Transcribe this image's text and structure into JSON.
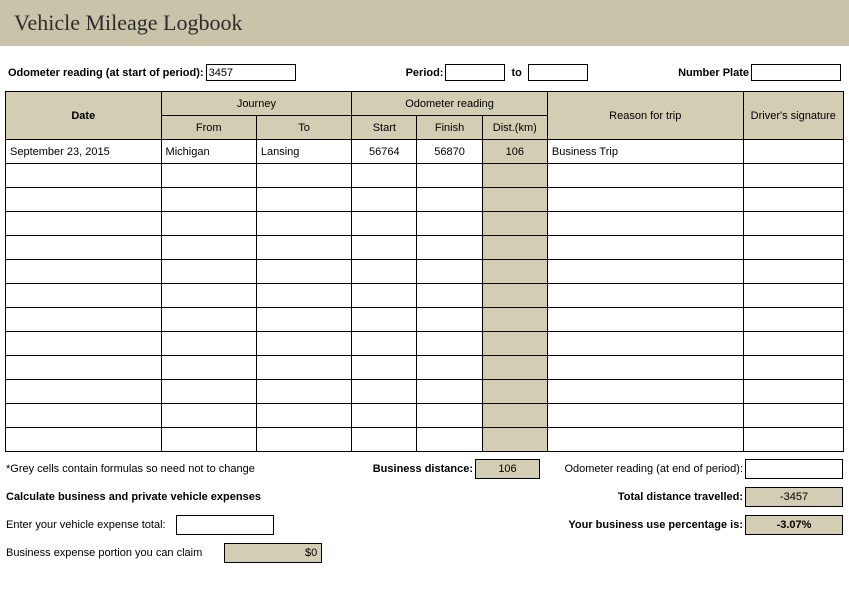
{
  "title": "Vehicle Mileage Logbook",
  "meta": {
    "odom_start_label": "Odometer reading (at start of period):",
    "odom_start_value": "3457",
    "period_label": "Period:",
    "period_from": "",
    "period_to_label": "to",
    "period_to": "",
    "plate_label": "Number Plate",
    "plate_value": ""
  },
  "headers": {
    "date": "Date",
    "journey": "Journey",
    "from": "From",
    "to": "To",
    "odometer_reading": "Odometer reading",
    "start": "Start",
    "finish": "Finish",
    "dist": "Dist.(km)",
    "reason": "Reason for trip",
    "signature": "Driver's signature"
  },
  "rows": [
    {
      "date": "September 23, 2015",
      "from": "Michigan",
      "to": "Lansing",
      "start": "56764",
      "finish": "56870",
      "dist": "106",
      "reason": "Business Trip",
      "sig": ""
    },
    {
      "date": "",
      "from": "",
      "to": "",
      "start": "",
      "finish": "",
      "dist": "",
      "reason": "",
      "sig": ""
    },
    {
      "date": "",
      "from": "",
      "to": "",
      "start": "",
      "finish": "",
      "dist": "",
      "reason": "",
      "sig": ""
    },
    {
      "date": "",
      "from": "",
      "to": "",
      "start": "",
      "finish": "",
      "dist": "",
      "reason": "",
      "sig": ""
    },
    {
      "date": "",
      "from": "",
      "to": "",
      "start": "",
      "finish": "",
      "dist": "",
      "reason": "",
      "sig": ""
    },
    {
      "date": "",
      "from": "",
      "to": "",
      "start": "",
      "finish": "",
      "dist": "",
      "reason": "",
      "sig": ""
    },
    {
      "date": "",
      "from": "",
      "to": "",
      "start": "",
      "finish": "",
      "dist": "",
      "reason": "",
      "sig": ""
    },
    {
      "date": "",
      "from": "",
      "to": "",
      "start": "",
      "finish": "",
      "dist": "",
      "reason": "",
      "sig": ""
    },
    {
      "date": "",
      "from": "",
      "to": "",
      "start": "",
      "finish": "",
      "dist": "",
      "reason": "",
      "sig": ""
    },
    {
      "date": "",
      "from": "",
      "to": "",
      "start": "",
      "finish": "",
      "dist": "",
      "reason": "",
      "sig": ""
    },
    {
      "date": "",
      "from": "",
      "to": "",
      "start": "",
      "finish": "",
      "dist": "",
      "reason": "",
      "sig": ""
    },
    {
      "date": "",
      "from": "",
      "to": "",
      "start": "",
      "finish": "",
      "dist": "",
      "reason": "",
      "sig": ""
    },
    {
      "date": "",
      "from": "",
      "to": "",
      "start": "",
      "finish": "",
      "dist": "",
      "reason": "",
      "sig": ""
    }
  ],
  "footer": {
    "grey_note": "*Grey cells contain formulas so need not to change",
    "business_distance_label": "Business distance:",
    "business_distance_value": "106",
    "odom_end_label": "Odometer reading (at end of period):",
    "odom_end_value": "",
    "calc_header": "Calculate business and private vehicle expenses",
    "total_distance_label": "Total distance travelled:",
    "total_distance_value": "-3457",
    "expense_total_label": "Enter your vehicle expense total:",
    "expense_total_value": "",
    "business_pct_label": "Your business use percentage is:",
    "business_pct_value": "-3.07%",
    "claim_label": "Business expense portion you can claim",
    "claim_value": "$0"
  }
}
